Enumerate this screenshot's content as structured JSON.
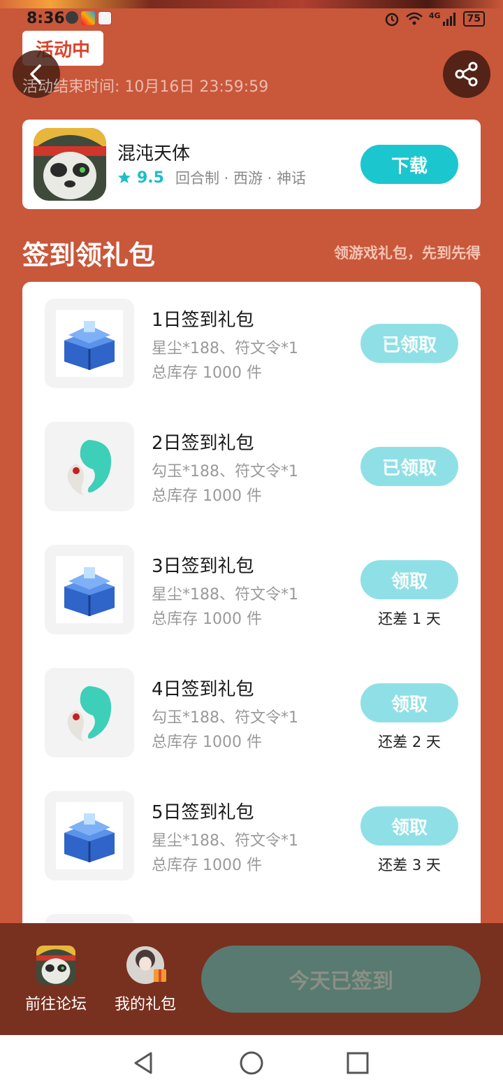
{
  "status_bar": {
    "time": "8:36",
    "battery": "75",
    "network": "4G"
  },
  "header": {
    "activity_badge": "活动中",
    "end_time": "活动结束时间: 10月16日 23:59:59"
  },
  "game": {
    "name": "混沌天体",
    "score": "9.5",
    "tags": "回合制 · 西游 · 神话",
    "download_label": "下载"
  },
  "section": {
    "title": "签到领礼包",
    "subtitle": "领游戏礼包，先到先得"
  },
  "gifts": [
    {
      "name": "1日签到礼包",
      "content": "星尘*188、符文令*1",
      "stock": "总库存 1000 件",
      "button": "已领取",
      "remain": "",
      "icon": "treasure-chest-icon"
    },
    {
      "name": "2日签到礼包",
      "content": "勾玉*188、符文令*1",
      "stock": "总库存 1000 件",
      "button": "已领取",
      "remain": "",
      "icon": "jade-magatama-icon"
    },
    {
      "name": "3日签到礼包",
      "content": "星尘*188、符文令*1",
      "stock": "总库存 1000 件",
      "button": "领取",
      "remain": "还差 1 天",
      "icon": "treasure-chest-icon"
    },
    {
      "name": "4日签到礼包",
      "content": "勾玉*188、符文令*1",
      "stock": "总库存 1000 件",
      "button": "领取",
      "remain": "还差 2 天",
      "icon": "jade-magatama-icon"
    },
    {
      "name": "5日签到礼包",
      "content": "星尘*188、符文令*1",
      "stock": "总库存 1000 件",
      "button": "领取",
      "remain": "还差 3 天",
      "icon": "treasure-chest-icon"
    }
  ],
  "bottom_bar": {
    "forum_label": "前往论坛",
    "my_gifts_label": "我的礼包",
    "signed_label": "今天已签到"
  },
  "colors": {
    "background": "#c9573a",
    "accent": "#1bc6cf",
    "accent_light": "#8fe0e6",
    "bottom_bar": "#78301f"
  }
}
